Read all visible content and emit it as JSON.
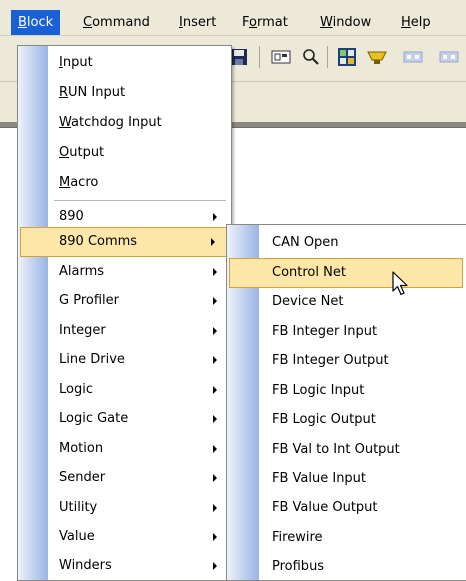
{
  "menubar": {
    "items": [
      {
        "pre": "",
        "key": "B",
        "post": "lock"
      },
      {
        "pre": "",
        "key": "C",
        "post": "ommand"
      },
      {
        "pre": "",
        "key": "I",
        "post": "nsert"
      },
      {
        "pre": "F",
        "key": "o",
        "post": "rmat"
      },
      {
        "pre": "",
        "key": "W",
        "post": "indow"
      },
      {
        "pre": "",
        "key": "H",
        "post": "elp"
      }
    ]
  },
  "block_menu": {
    "items": [
      {
        "pre": "",
        "key": "I",
        "post": "nput"
      },
      {
        "pre": "",
        "key": "R",
        "post": "UN Input"
      },
      {
        "pre": "",
        "key": "W",
        "post": "atchdog Input"
      },
      {
        "pre": "",
        "key": "O",
        "post": "utput"
      },
      {
        "pre": "",
        "key": "M",
        "post": "acro"
      }
    ],
    "submenus": [
      "890",
      "890 Comms",
      "Alarms",
      "G Profiler",
      "Integer",
      "Line Drive",
      "Logic",
      "Logic Gate",
      "Motion",
      "Sender",
      "Utility",
      "Value",
      "Winders"
    ],
    "highlighted": "890 Comms"
  },
  "comms_menu": {
    "items": [
      "CAN Open",
      "Control Net",
      "Device Net",
      "FB Integer Input",
      "FB Integer Output",
      "FB Logic Input",
      "FB Logic Output",
      "FB Val to Int Output",
      "FB Value Input",
      "FB Value Output",
      "Firewire",
      "Profibus"
    ],
    "highlighted": "Control Net"
  },
  "colors": {
    "menu_highlight": "#fde7a8",
    "menubar_active": "#1960d6",
    "gutter": "#bfd0ef"
  },
  "icons": [
    "save-icon",
    "block-icon",
    "zoom-icon",
    "grid-icon",
    "connect-icon",
    "link-icon",
    "link-icon"
  ]
}
